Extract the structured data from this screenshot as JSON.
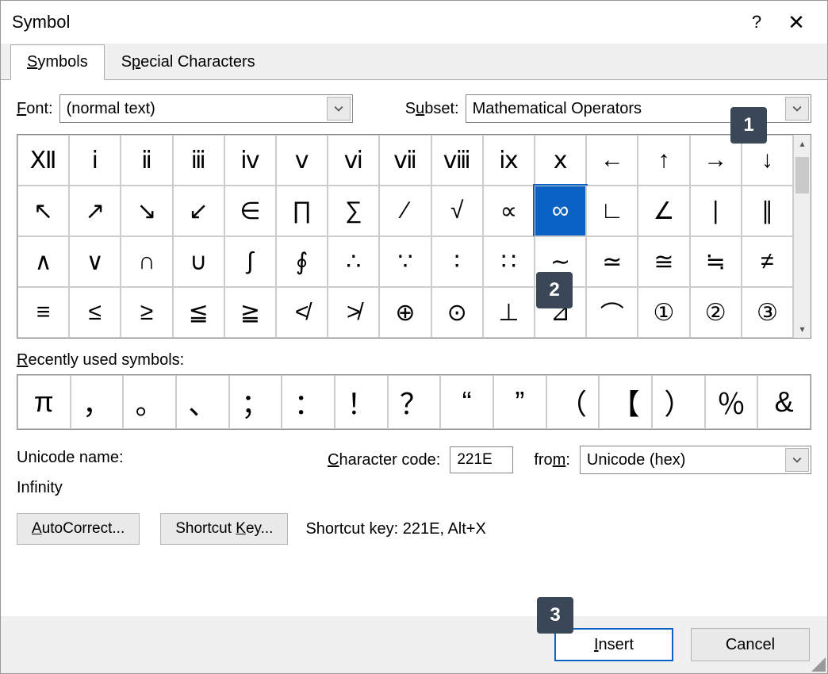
{
  "window": {
    "title": "Symbol",
    "help_icon": "?",
    "close_icon": "✕"
  },
  "tabs": {
    "symbols": "Symbols",
    "special": "Special Characters"
  },
  "font": {
    "label": "Font:",
    "value": "(normal text)"
  },
  "subset": {
    "label": "Subset:",
    "value": "Mathematical Operators"
  },
  "grid": {
    "rows": [
      [
        "Ⅻ",
        "ⅰ",
        "ⅱ",
        "ⅲ",
        "ⅳ",
        "ⅴ",
        "ⅵ",
        "ⅶ",
        "ⅷ",
        "ⅸ",
        "ⅹ",
        "←",
        "↑",
        "→",
        "↓"
      ],
      [
        "↖",
        "↗",
        "↘",
        "↙",
        "∈",
        "∏",
        "∑",
        "∕",
        "√",
        "∝",
        "∞",
        "∟",
        "∠",
        "∣",
        "∥"
      ],
      [
        "∧",
        "∨",
        "∩",
        "∪",
        "∫",
        "∮",
        "∴",
        "∵",
        "∶",
        "∷",
        "∼",
        "≃",
        "≅",
        "≒",
        "≠"
      ],
      [
        "≡",
        "≤",
        "≥",
        "≦",
        "≧",
        "≮",
        "≯",
        "⊕",
        "⊙",
        "⊥",
        "⊿",
        "⌒",
        "①",
        "②",
        "③"
      ]
    ],
    "selected": {
      "row": 1,
      "col": 10
    }
  },
  "recent": {
    "label": "Recently used symbols:",
    "items": [
      "π",
      "，",
      "。",
      "、",
      "；",
      "：",
      "！",
      "？",
      "“",
      "”",
      "（",
      "【",
      "）",
      "％",
      "&"
    ]
  },
  "unicode": {
    "name_label": "Unicode name:",
    "name_value": "Infinity",
    "code_label": "Character code:",
    "code_value": "221E",
    "from_label": "from:",
    "from_value": "Unicode (hex)"
  },
  "buttons": {
    "autocorrect": "AutoCorrect...",
    "shortcut_key": "Shortcut Key...",
    "shortcut_info_label": "Shortcut key:",
    "shortcut_info_value": "221E, Alt+X",
    "insert": "Insert",
    "cancel": "Cancel"
  },
  "callouts": {
    "c1": "1",
    "c2": "2",
    "c3": "3"
  }
}
